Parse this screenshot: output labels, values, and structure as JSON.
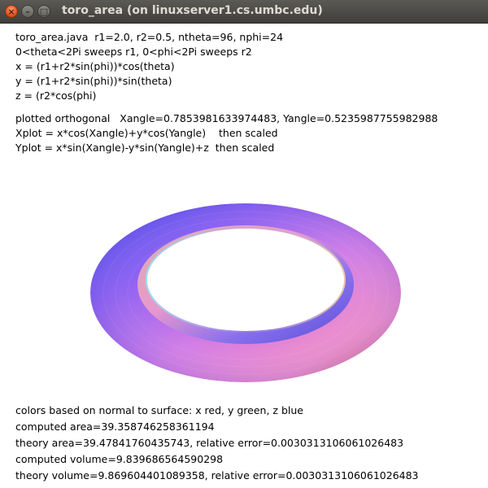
{
  "window": {
    "title": "toro_area (on linuxserver1.cs.umbc.edu)",
    "close_glyph": "×",
    "minimize_glyph": "–",
    "maximize_glyph": "□"
  },
  "header_lines": [
    "toro_area.java  r1=2.0, r2=0.5, ntheta=96, nphi=24",
    "0<theta<2Pi sweeps r1, 0<phi<2Pi sweeps r2",
    "x = (r1+r2*sin(phi))*cos(theta)",
    "y = (r1+r2*sin(phi))*sin(theta)",
    "z = (r2*cos(phi)"
  ],
  "projection_lines": [
    "plotted orthogonal   Xangle=0.7853981633974483, Yangle=0.5235987755982988",
    "Xplot = x*cos(Xangle)+y*cos(Yangle)    then scaled",
    "Yplot = x*sin(Xangle)-y*sin(Yangle)+z  then scaled"
  ],
  "footer_lines": [
    "colors based on normal to surface: x red, y green, z blue",
    "computed area=39.358746258361194",
    "theory area=39.47841760435743, relative error=0.0030313106061026483",
    "computed volume=9.839686564590298",
    "theory volume=9.869604401089358, relative error=0.0030313106061026483"
  ],
  "colors": {
    "titlebar": "#4c4b47",
    "title_text": "#dfdbd2",
    "close_button": "#e2551f",
    "torus_purple": "#8c5bf0",
    "torus_pink": "#f08cc8",
    "torus_blue": "#4a4ef0",
    "torus_cyan": "#9be0f0",
    "torus_coral": "#f0786e"
  },
  "icons": {
    "close": "close-icon",
    "minimize": "minimize-icon",
    "maximize": "maximize-icon"
  }
}
